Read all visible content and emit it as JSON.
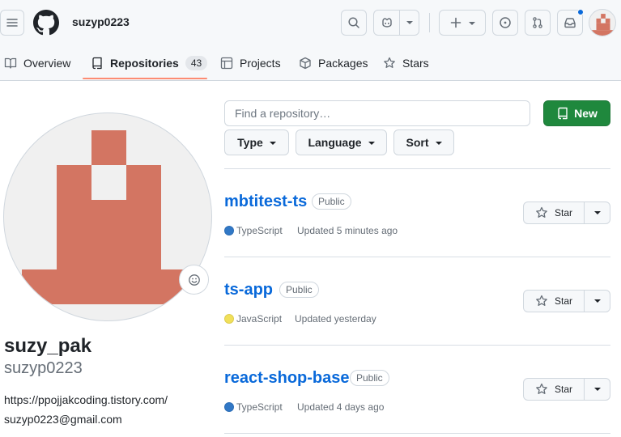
{
  "header": {
    "username": "suzyp0223",
    "icons": [
      "hamburger-icon",
      "github-logo-icon",
      "search-icon",
      "copilot-icon",
      "chevron-down-icon",
      "plus-icon",
      "issue-icon",
      "pull-request-icon",
      "inbox-icon",
      "avatar"
    ],
    "notification_dot_color": "#0969da"
  },
  "tabs": [
    {
      "label": "Overview",
      "icon": "book-icon"
    },
    {
      "label": "Repositories",
      "icon": "repo-icon",
      "count": "43",
      "selected": true
    },
    {
      "label": "Projects",
      "icon": "table-icon"
    },
    {
      "label": "Packages",
      "icon": "package-icon"
    },
    {
      "label": "Stars",
      "icon": "star-icon"
    }
  ],
  "profile": {
    "fullname": "suzy_pak",
    "login": "suzyp0223",
    "website": "https://ppojjakcoding.tistory.com/",
    "email": "suzyp0223@gmail.com",
    "avatar_color": "#d37562"
  },
  "filter": {
    "search_placeholder": "Find a repository…",
    "new_label": "New",
    "type_label": "Type",
    "language_label": "Language",
    "sort_label": "Sort"
  },
  "repos": [
    {
      "name": "mbtitest-ts",
      "visibility": "Public",
      "language": "TypeScript",
      "language_color": "#3178c6",
      "updated": "Updated 5 minutes ago",
      "star_label": "Star"
    },
    {
      "name": "ts-app",
      "visibility": "Public",
      "language": "JavaScript",
      "language_color": "#f1e05a",
      "updated": "Updated yesterday",
      "star_label": "Star"
    },
    {
      "name": "react-shop-base",
      "visibility": "Public",
      "language": "TypeScript",
      "language_color": "#3178c6",
      "updated": "Updated 4 days ago",
      "star_label": "Star"
    }
  ],
  "colors": {
    "accent_link": "#0969da",
    "primary_green": "#1f883d",
    "selected_tab_underline": "#fd8c73"
  }
}
